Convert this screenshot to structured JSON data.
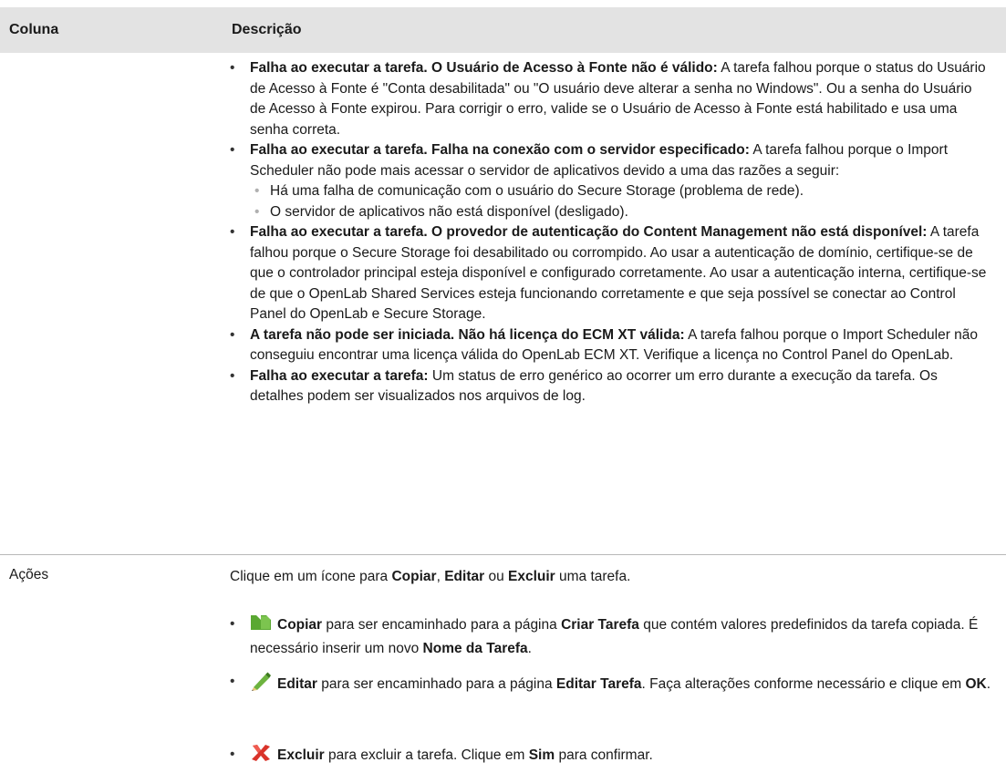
{
  "header": {
    "col1": "Coluna",
    "col2": "Descrição"
  },
  "status_items": [
    {
      "bold": "Falha ao executar a tarefa. O Usuário de Acesso à Fonte não é válido:",
      "text": " A tarefa falhou porque o status do Usuário de Acesso à Fonte é \"Conta desabilitada\" ou \"O usuário deve alterar a senha no Windows\". Ou a senha do Usuário de Acesso à Fonte expirou. Para corrigir o erro, valide se o Usuário de Acesso à Fonte está habilitado e usa uma senha correta."
    },
    {
      "bold": "Falha ao executar a tarefa. Falha na conexão com o servidor especificado:",
      "text": " A tarefa falhou porque o Import Scheduler não pode mais acessar o servidor de aplicativos devido a uma das razões a seguir:",
      "sub": [
        "Há uma falha de comunicação com o usuário do Secure Storage (problema de rede).",
        "O servidor de aplicativos não está disponível (desligado)."
      ]
    },
    {
      "bold": "Falha ao executar a tarefa. O provedor de autenticação do Content Management não está disponível:",
      "text": " A tarefa falhou porque o Secure Storage foi desabilitado ou corrompido. Ao usar a autenticação de domínio, certifique-se de que o controlador principal esteja disponível e confi­gurado corretamente. Ao usar a autenticação interna, certifique-se de que o OpenLab Shared Services esteja funcionando corretamente e que seja possível se conectar ao Control Panel do OpenLab e Secure Storage."
    },
    {
      "bold": "A tarefa não pode ser iniciada. Não há licença do ECM XT válida:",
      "text": " A tarefa falhou porque o Import Scheduler não conseguiu encontrar uma licença válida do OpenLab ECM XT. Verifique a licença no Control Panel do OpenLab."
    },
    {
      "bold": "Falha ao executar a tarefa:",
      "text": " Um status de erro genérico ao ocorrer um erro durante a execução da tarefa. Os detalhes podem ser visualizados nos arquivos de log."
    }
  ],
  "acoes": {
    "label": "Ações",
    "intro": {
      "t1": "Clique em um ícone para ",
      "copiar": "Copiar",
      "t2": ", ",
      "editar": "Editar",
      "t3": " ou ",
      "excluir": "Excluir",
      "t4": " uma tarefa."
    },
    "copy": {
      "b1": "Copiar",
      "t1": " para ser encaminhado para a página ",
      "b2": "Criar Tarefa",
      "t2": " que contém valores predefinidos da tarefa copiada. É necessário inserir um novo ",
      "b3": "Nome da Tarefa",
      "t3": "."
    },
    "edit": {
      "b1": "Editar",
      "t1": " para ser encaminhado para a página ",
      "b2": "Editar Tarefa",
      "t2": ". Faça alterações conforme necessário e clique em ",
      "b3": "OK",
      "t3": "."
    },
    "delete": {
      "b1": "Excluir",
      "t1": " para excluir a tarefa. Clique em ",
      "b2": "Sim",
      "t2": " para confirmar."
    }
  },
  "icons": {
    "copy": "copy-icon",
    "edit": "pencil-icon",
    "delete": "delete-x-icon"
  },
  "colors": {
    "header_bg": "#e3e3e3",
    "copy_icon": "#5aa832",
    "delete_icon": "#d9332a"
  }
}
